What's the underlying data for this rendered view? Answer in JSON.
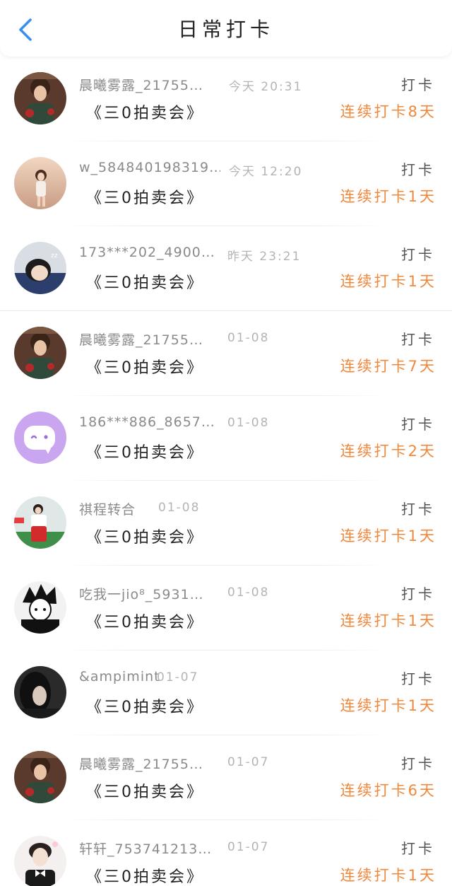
{
  "header": {
    "title": "日常打卡",
    "back_icon": "chevron-left-icon",
    "accent_color": "#3b8ef0"
  },
  "colors": {
    "streak": "#f0883c",
    "name": "#8a8a8a",
    "time": "#b4b4b4"
  },
  "items": [
    {
      "name": "晨曦雾露_21755…",
      "time": "今天 20:31",
      "content": "《三0拍卖会》",
      "action": "打卡",
      "streak": "连续打卡8天",
      "avatar": "avatar-warrior"
    },
    {
      "name": "w_584840198319…",
      "time": "今天 12:20",
      "content": "《三0拍卖会》",
      "action": "打卡",
      "streak": "连续打卡1天",
      "avatar": "avatar-girl-sunset"
    },
    {
      "name": "173***202_4900…",
      "time": "昨天 23:21",
      "content": "《三0拍卖会》",
      "action": "打卡",
      "streak": "连续打卡1天",
      "avatar": "avatar-sleeping"
    },
    {
      "name": "晨曦雾露_21755…",
      "time": "01-08",
      "content": "《三0拍卖会》",
      "action": "打卡",
      "streak": "连续打卡7天",
      "avatar": "avatar-warrior"
    },
    {
      "name": "186***886_8657…",
      "time": "01-08",
      "content": "《三0拍卖会》",
      "action": "打卡",
      "streak": "连续打卡2天",
      "avatar": "avatar-purple-face"
    },
    {
      "name": "祺程转合",
      "time": "01-08",
      "content": "《三0拍卖会》",
      "action": "打卡",
      "streak": "连续打卡1天",
      "avatar": "avatar-red-outfit"
    },
    {
      "name": "吃我一jio⁸_5931…",
      "time": "01-08",
      "content": "《三0拍卖会》",
      "action": "打卡",
      "streak": "连续打卡1天",
      "avatar": "avatar-bw-sketch"
    },
    {
      "name": "&ampimint",
      "time": "01-07",
      "content": "《三0拍卖会》",
      "action": "打卡",
      "streak": "连续打卡1天",
      "avatar": "avatar-dark-portrait"
    },
    {
      "name": "晨曦雾露_21755…",
      "time": "01-07",
      "content": "《三0拍卖会》",
      "action": "打卡",
      "streak": "连续打卡6天",
      "avatar": "avatar-warrior"
    },
    {
      "name": "轩轩_753741213…",
      "time": "01-07",
      "content": "《三0拍卖会》",
      "action": "打卡",
      "streak": "连续打卡1天",
      "avatar": "avatar-boy-bowtie"
    }
  ]
}
